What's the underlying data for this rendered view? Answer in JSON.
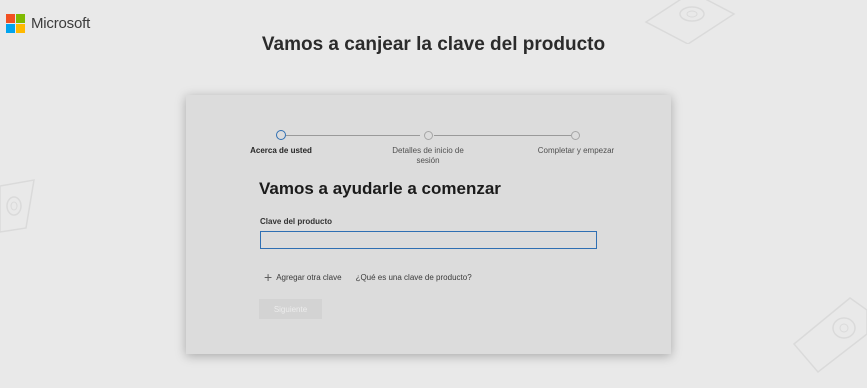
{
  "brand": {
    "name": "Microsoft",
    "logo_colors": [
      "#f25022",
      "#7fba00",
      "#00a4ef",
      "#ffb900"
    ]
  },
  "page": {
    "title": "Vamos a canjear la clave del producto"
  },
  "stepper": {
    "accent": "#2f6fb3",
    "steps": [
      {
        "label": "Acerca de usted",
        "active": true
      },
      {
        "label": "Detalles de inicio de sesión",
        "active": false
      },
      {
        "label": "Completar y empezar",
        "active": false
      }
    ]
  },
  "form": {
    "heading": "Vamos a ayudarle a comenzar",
    "product_key_label": "Clave del producto",
    "product_key_value": "",
    "product_key_placeholder": ""
  },
  "links": {
    "add_key_icon": "plus-icon",
    "add_key": "Agregar otra clave",
    "what_is_key": "¿Qué es una clave de producto?"
  },
  "actions": {
    "next_label": "Siguiente",
    "next_enabled": false
  }
}
